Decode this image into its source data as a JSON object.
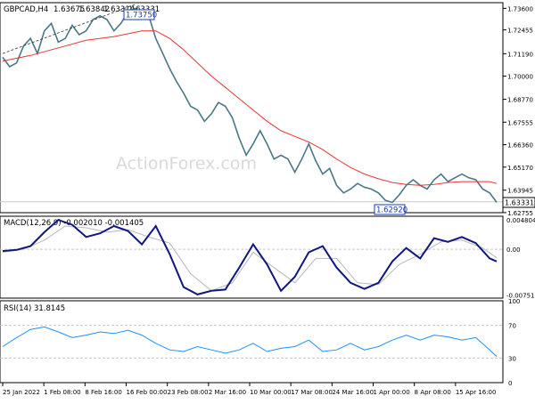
{
  "chart_data": {
    "type": "line",
    "symbol": "GBPCAD,H4",
    "ohlc": {
      "open": "1.63675",
      "high": "1.63842",
      "low": "1.63314",
      "close": "1.63331"
    },
    "watermark": "ActionForex.com",
    "colors": {
      "price": "#4a7788",
      "ma": "#ef3333",
      "macd": "#101880",
      "signal": "#b8b8b8",
      "rsi": "#1e90ff",
      "level": "#c8c8c8",
      "frame": "#000000",
      "watermark": "#d9d9d9",
      "callout": "#1a3bb3"
    },
    "x_labels": [
      "25 Jan 2022",
      "1 Feb 08:00",
      "8 Feb 16:00",
      "16 Feb 00:00",
      "23 Feb 08:00",
      "2 Mar 16:00",
      "10 Mar 00:00",
      "17 Mar 08:00",
      "24 Mar 16:00",
      "1 Apr 00:00",
      "8 Apr 08:00",
      "15 Apr 16:00"
    ],
    "main": {
      "ylim": [
        1.6275,
        1.739
      ],
      "ticks": [
        "1.73600",
        "1.72455",
        "1.71190",
        "1.70000",
        "1.68770",
        "1.67555",
        "1.66360",
        "1.65170",
        "1.63945",
        "1.62755"
      ],
      "last_price": "1.63331",
      "high_label": "1.73750",
      "low_label": "1.62920",
      "price": [
        [
          0,
          1.71
        ],
        [
          1,
          1.705
        ],
        [
          2,
          1.707
        ],
        [
          3,
          1.716
        ],
        [
          4,
          1.72
        ],
        [
          5,
          1.712
        ],
        [
          6,
          1.724
        ],
        [
          7,
          1.728
        ],
        [
          8,
          1.718
        ],
        [
          9,
          1.72
        ],
        [
          10,
          1.727
        ],
        [
          11,
          1.722
        ],
        [
          12,
          1.724
        ],
        [
          13,
          1.73
        ],
        [
          14,
          1.732
        ],
        [
          15,
          1.73
        ],
        [
          16,
          1.724
        ],
        [
          17,
          1.728
        ],
        [
          18,
          1.734
        ],
        [
          19,
          1.736
        ],
        [
          20,
          1.733
        ],
        [
          21,
          1.732
        ],
        [
          22,
          1.72
        ],
        [
          23,
          1.712
        ],
        [
          24,
          1.704
        ],
        [
          25,
          1.697
        ],
        [
          26,
          1.691
        ],
        [
          27,
          1.684
        ],
        [
          28,
          1.682
        ],
        [
          29,
          1.676
        ],
        [
          30,
          1.68
        ],
        [
          31,
          1.686
        ],
        [
          32,
          1.684
        ],
        [
          33,
          1.678
        ],
        [
          34,
          1.667
        ],
        [
          35,
          1.658
        ],
        [
          36,
          1.664
        ],
        [
          37,
          1.671
        ],
        [
          38,
          1.664
        ],
        [
          39,
          1.656
        ],
        [
          40,
          1.658
        ],
        [
          41,
          1.656
        ],
        [
          42,
          1.649
        ],
        [
          43,
          1.656
        ],
        [
          44,
          1.664
        ],
        [
          45,
          1.655
        ],
        [
          46,
          1.648
        ],
        [
          47,
          1.651
        ],
        [
          48,
          1.642
        ],
        [
          49,
          1.638
        ],
        [
          50,
          1.64
        ],
        [
          51,
          1.643
        ],
        [
          52,
          1.641
        ],
        [
          53,
          1.64
        ],
        [
          54,
          1.638
        ],
        [
          55,
          1.634
        ],
        [
          56,
          1.633
        ],
        [
          57,
          1.637
        ],
        [
          58,
          1.642
        ],
        [
          59,
          1.645
        ],
        [
          60,
          1.642
        ],
        [
          61,
          1.64
        ],
        [
          62,
          1.645
        ],
        [
          63,
          1.648
        ],
        [
          64,
          1.644
        ],
        [
          65,
          1.646
        ],
        [
          66,
          1.648
        ],
        [
          67,
          1.646
        ],
        [
          68,
          1.645
        ],
        [
          69,
          1.64
        ],
        [
          70,
          1.638
        ],
        [
          71,
          1.633
        ]
      ],
      "ma": [
        [
          0,
          1.708
        ],
        [
          4,
          1.711
        ],
        [
          8,
          1.715
        ],
        [
          12,
          1.719
        ],
        [
          16,
          1.721
        ],
        [
          20,
          1.724
        ],
        [
          22,
          1.724
        ],
        [
          24,
          1.72
        ],
        [
          26,
          1.714
        ],
        [
          28,
          1.707
        ],
        [
          30,
          1.7
        ],
        [
          32,
          1.694
        ],
        [
          34,
          1.688
        ],
        [
          36,
          1.682
        ],
        [
          38,
          1.676
        ],
        [
          40,
          1.671
        ],
        [
          42,
          1.668
        ],
        [
          44,
          1.665
        ],
        [
          46,
          1.661
        ],
        [
          48,
          1.656
        ],
        [
          50,
          1.6515
        ],
        [
          52,
          1.648
        ],
        [
          54,
          1.6455
        ],
        [
          56,
          1.6435
        ],
        [
          58,
          1.6425
        ],
        [
          60,
          1.642
        ],
        [
          62,
          1.6425
        ],
        [
          64,
          1.6435
        ],
        [
          66,
          1.644
        ],
        [
          68,
          1.644
        ],
        [
          70,
          1.644
        ],
        [
          71,
          1.643
        ]
      ]
    },
    "macd": {
      "label": "MACD(12,26,9) -0.002010 -0.001405",
      "ylim": [
        -0.008,
        0.0054
      ],
      "ticks": [
        "0.004804",
        "0.00",
        "-0.007511"
      ],
      "macd": [
        [
          0,
          -0.0003
        ],
        [
          2,
          -0.0001
        ],
        [
          4,
          0.0005
        ],
        [
          6,
          0.0028
        ],
        [
          8,
          0.0048
        ],
        [
          10,
          0.004
        ],
        [
          12,
          0.002
        ],
        [
          14,
          0.0026
        ],
        [
          16,
          0.0038
        ],
        [
          18,
          0.003
        ],
        [
          20,
          0.0008
        ],
        [
          22,
          0.0038
        ],
        [
          24,
          -0.0008
        ],
        [
          26,
          -0.0062
        ],
        [
          28,
          -0.0074
        ],
        [
          30,
          -0.0068
        ],
        [
          32,
          -0.0066
        ],
        [
          34,
          -0.003
        ],
        [
          36,
          0.0008
        ],
        [
          38,
          -0.0025
        ],
        [
          40,
          -0.0068
        ],
        [
          42,
          -0.0045
        ],
        [
          44,
          -0.0005
        ],
        [
          46,
          0.0005
        ],
        [
          48,
          -0.003
        ],
        [
          50,
          -0.0055
        ],
        [
          52,
          -0.0065
        ],
        [
          54,
          -0.0055
        ],
        [
          56,
          -0.002
        ],
        [
          58,
          0.0002
        ],
        [
          60,
          -0.0015
        ],
        [
          62,
          0.0018
        ],
        [
          64,
          0.0012
        ],
        [
          66,
          0.002
        ],
        [
          68,
          0.001
        ],
        [
          70,
          -0.0015
        ],
        [
          71,
          -0.002
        ]
      ],
      "signal": [
        [
          0,
          -0.0005
        ],
        [
          3,
          0.0
        ],
        [
          6,
          0.0015
        ],
        [
          9,
          0.0038
        ],
        [
          12,
          0.0035
        ],
        [
          15,
          0.0028
        ],
        [
          18,
          0.0032
        ],
        [
          21,
          0.002
        ],
        [
          24,
          0.001
        ],
        [
          27,
          -0.004
        ],
        [
          30,
          -0.0068
        ],
        [
          33,
          -0.0055
        ],
        [
          36,
          -0.0005
        ],
        [
          39,
          -0.003
        ],
        [
          42,
          -0.0055
        ],
        [
          45,
          -0.0015
        ],
        [
          48,
          -0.0015
        ],
        [
          51,
          -0.0055
        ],
        [
          54,
          -0.0058
        ],
        [
          57,
          -0.0025
        ],
        [
          60,
          -0.0008
        ],
        [
          63,
          0.0012
        ],
        [
          66,
          0.0015
        ],
        [
          69,
          0.0002
        ],
        [
          71,
          -0.0014
        ]
      ]
    },
    "rsi": {
      "label": "RSI(14) 31.8145",
      "ylim": [
        0,
        100
      ],
      "ticks": [
        "100",
        "70",
        "30",
        "0"
      ],
      "levels": [
        70,
        30
      ],
      "values": [
        [
          0,
          44
        ],
        [
          2,
          55
        ],
        [
          4,
          65
        ],
        [
          6,
          68
        ],
        [
          8,
          62
        ],
        [
          10,
          55
        ],
        [
          12,
          58
        ],
        [
          14,
          62
        ],
        [
          16,
          60
        ],
        [
          18,
          64
        ],
        [
          20,
          58
        ],
        [
          22,
          48
        ],
        [
          24,
          40
        ],
        [
          26,
          38
        ],
        [
          28,
          44
        ],
        [
          30,
          40
        ],
        [
          32,
          36
        ],
        [
          34,
          40
        ],
        [
          36,
          48
        ],
        [
          38,
          38
        ],
        [
          40,
          42
        ],
        [
          42,
          44
        ],
        [
          44,
          52
        ],
        [
          46,
          38
        ],
        [
          48,
          40
        ],
        [
          50,
          48
        ],
        [
          52,
          40
        ],
        [
          54,
          44
        ],
        [
          56,
          52
        ],
        [
          58,
          58
        ],
        [
          60,
          52
        ],
        [
          62,
          58
        ],
        [
          64,
          56
        ],
        [
          66,
          52
        ],
        [
          68,
          55
        ],
        [
          70,
          40
        ],
        [
          71,
          32
        ]
      ]
    }
  }
}
